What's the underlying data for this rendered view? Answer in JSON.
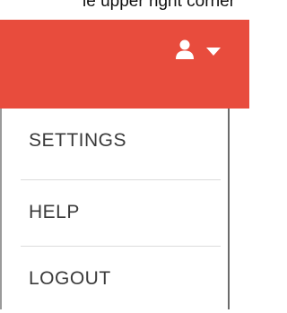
{
  "caption": "ie upper right corner",
  "header": {
    "background_color": "#e84c3d",
    "user_icon": "user-icon",
    "dropdown_icon": "chevron-down-icon"
  },
  "menu": {
    "items": [
      {
        "label": "SETTINGS"
      },
      {
        "label": "HELP"
      },
      {
        "label": "LOGOUT"
      }
    ]
  }
}
